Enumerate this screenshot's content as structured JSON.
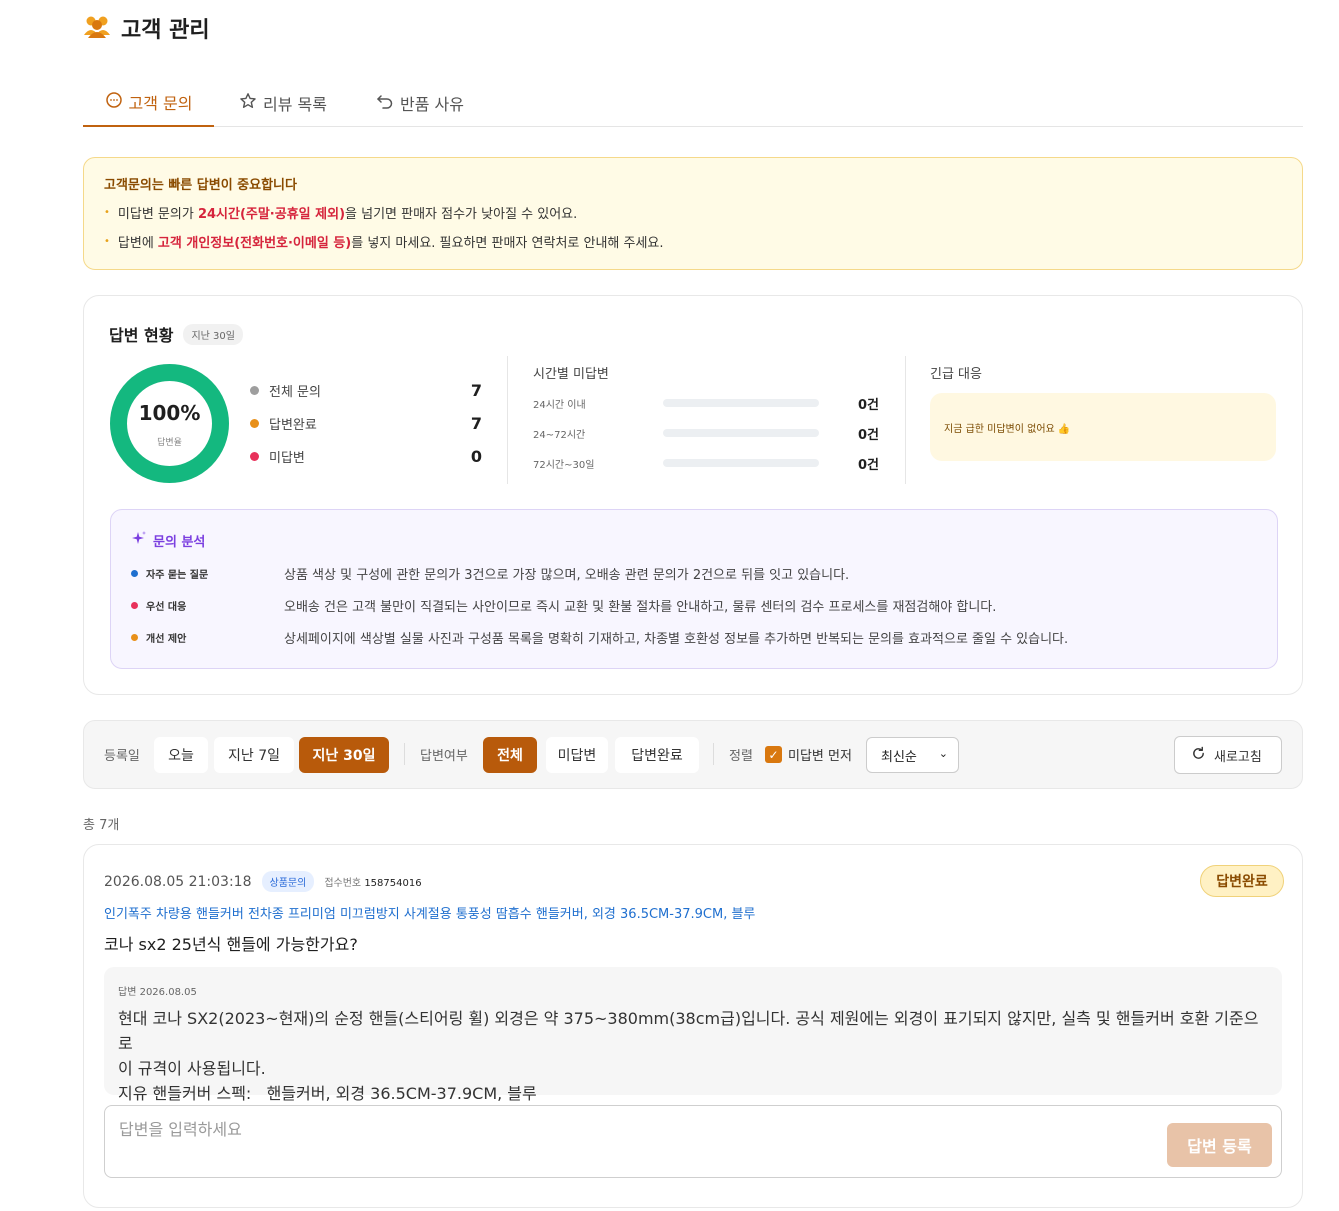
{
  "header": {
    "title": "고객 관리",
    "icon": "users-icon"
  },
  "tabs": [
    {
      "label": "고객 문의",
      "icon": "chat-icon",
      "active": true
    },
    {
      "label": "리뷰 목록",
      "icon": "star-icon",
      "active": false
    },
    {
      "label": "반품 사유",
      "icon": "return-icon",
      "active": false
    }
  ],
  "notice": {
    "title": "고객문의는 빠른 답변이 중요합니다",
    "line1": {
      "pre": "미답변 문의가 ",
      "emph": "24시간(주말·공휴일 제외)",
      "post": "을 넘기면 판매자 점수가 낮아질 수 있어요."
    },
    "line2": {
      "pre": "답변에 ",
      "emph": "고객 개인정보(전화번호·이메일 등)",
      "post": "를 넣지 마세요. 필요하면 판매자 연락처로 안내해 주세요."
    }
  },
  "status": {
    "title": "답변 현황",
    "period": "지난 30일",
    "rate": "100%",
    "rate_label": "답변율",
    "rate_value": 1.0,
    "legend": [
      {
        "label": "전체 문의",
        "value": "7",
        "color": "#9e9e9e"
      },
      {
        "label": "답변완료",
        "value": "7",
        "color": "#e8901a"
      },
      {
        "label": "미답변",
        "value": "0",
        "color": "#e8315b"
      }
    ],
    "time_title": "시간별 미답변",
    "time_rows": [
      {
        "label": "24시간 이내",
        "count": "0건"
      },
      {
        "label": "24~72시간",
        "count": "0건"
      },
      {
        "label": "72시간~30일",
        "count": "0건"
      }
    ],
    "urgent_title": "긴급 대응",
    "urgent_msg": "지금 급한 미답변이 없어요 👍"
  },
  "analysis": {
    "title": "문의 분석",
    "rows": [
      {
        "label": "자주 묻는 질문",
        "color": "#1f6fcf",
        "text": "상품 색상 및 구성에 관한 문의가 3건으로 가장 많으며, 오배송 관련 문의가 2건으로 뒤를 잇고 있습니다."
      },
      {
        "label": "우선 대응",
        "color": "#e8315b",
        "text": "오배송 건은 고객 불만이 직결되는 사안이므로 즉시 교환 및 환불 절차를 안내하고, 물류 센터의 검수 프로세스를 재점검해야 합니다."
      },
      {
        "label": "개선 제안",
        "color": "#e8901a",
        "text": "상세페이지에 색상별 실물 사진과 구성품 목록을 명확히 기재하고, 차종별 호환성 정보를 추가하면 반복되는 문의를 효과적으로 줄일 수 있습니다."
      }
    ]
  },
  "filters": {
    "date_label": "등록일",
    "date_options": [
      "오늘",
      "지난 7일",
      "지난 30일"
    ],
    "answer_label": "답변여부",
    "answer_options": [
      "전체",
      "미답변",
      "답변완료"
    ],
    "sort_label": "정렬",
    "unanswered_first": "미답변 먼저",
    "sort_value": "최신순",
    "refresh": "새로고침"
  },
  "total": "총 7개",
  "inquiry": {
    "datetime": "2026.08.05 21:03:18",
    "type": "상품문의",
    "receipt_label": "접수번호",
    "receipt_no": "158754016",
    "status": "답변완료",
    "product": "인기폭주 차량용 핸들커버 전차종 프리미엄 미끄럼방지 사계절용 통풍성 땀흡수 핸들커버, 외경 36.5CM-37.9CM, 블루",
    "question": "코나 sx2 25년식 핸들에 가능한가요?",
    "answer_date": "답변 2026.08.05",
    "answer_line1": "현대 코나 SX2(2023~현재)의 순정 핸들(스티어링 휠) 외경은 약 375~380mm(38cm급)입니다. 공식 제원에는 외경이 표기되지 않지만, 실측 및 핸들커버 호환 기준으로",
    "answer_line2": "이 규격이 사용됩니다.",
    "answer_line3": "지유 핸들커버 스펙:   핸들커버, 외경 36.5CM-37.9CM, 블루",
    "reply_placeholder": "답변을 입력하세요",
    "reply_button": "답변 등록"
  }
}
